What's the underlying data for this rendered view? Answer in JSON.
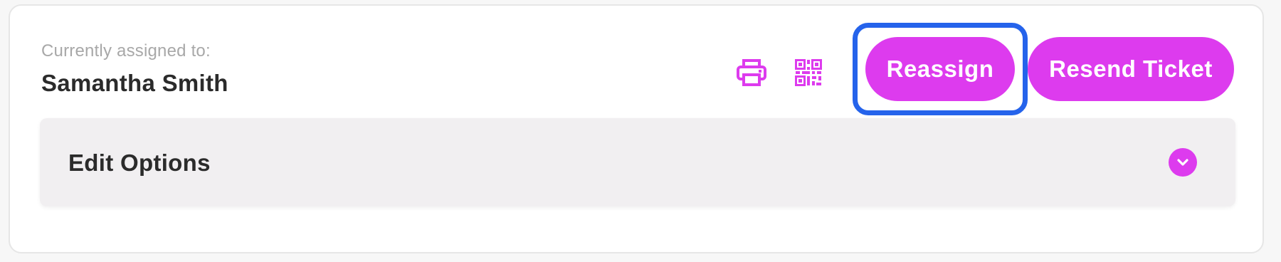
{
  "assignment": {
    "label": "Currently assigned to:",
    "name": "Samantha Smith"
  },
  "actions": {
    "print_icon": "printer-icon",
    "qr_icon": "qr-code-icon",
    "reassign_label": "Reassign",
    "resend_label": "Resend Ticket"
  },
  "edit_options": {
    "title": "Edit Options",
    "toggle_icon": "chevron-down-icon"
  },
  "colors": {
    "accent": "#dd3bee",
    "highlight": "#2563eb",
    "panel": "#f1eff1",
    "text": "#2b2b2b",
    "muted": "#a8a8a8"
  }
}
